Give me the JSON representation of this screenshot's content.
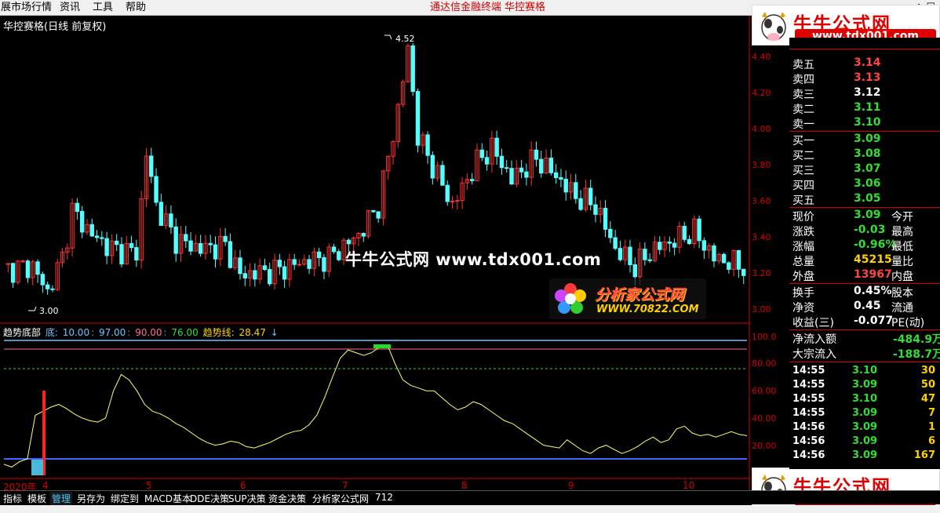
{
  "menu": {
    "items": [
      "展市场行情",
      "资讯",
      "工具",
      "帮助"
    ],
    "center_items": [
      "通达信金融终端",
      "华控赛格"
    ],
    "win_controls": "◇ ☐"
  },
  "chart": {
    "title": "华控赛格(日线 前复权)",
    "y_labels": [
      "4.40",
      "4.20",
      "4.00",
      "3.80",
      "3.60",
      "3.40",
      "3.20",
      "3.00"
    ],
    "high_label": "4.52",
    "low_label": "3.00",
    "ind_y_labels": [
      "100.0",
      "80.00",
      "60.00",
      "40.00",
      "20.00"
    ],
    "x_labels": [
      "2020年",
      "4",
      "5",
      "6",
      "7",
      "8",
      "9",
      "10"
    ]
  },
  "indicator": {
    "name": "趋势底部",
    "bottom_label": "底:",
    "v1": "10.00",
    "v2": "97.00",
    "v3": "90.00",
    "v4": "76.00",
    "trend_label": "趋势线:",
    "trend_value": "28.47",
    "arrow": "↓"
  },
  "watermark": {
    "center": "牛牛公式网 www.tdx001.com",
    "fx_title": "分析家公式网",
    "fx_url": "WWW.70822.COM"
  },
  "logos": {
    "title": "牛牛公式网",
    "url": "www.tdx001.com"
  },
  "quote": {
    "sells": [
      {
        "label": "卖五",
        "price": "3.14",
        "color": "#ff4444"
      },
      {
        "label": "卖四",
        "price": "3.13",
        "color": "#ff4444"
      },
      {
        "label": "卖三",
        "price": "3.12",
        "color": "#ffffff"
      },
      {
        "label": "卖二",
        "price": "3.11",
        "color": "#33dd33"
      },
      {
        "label": "卖一",
        "price": "3.10",
        "color": "#33dd33"
      }
    ],
    "buys": [
      {
        "label": "买一",
        "price": "3.09",
        "color": "#33dd33"
      },
      {
        "label": "买二",
        "price": "3.08",
        "color": "#33dd33"
      },
      {
        "label": "买三",
        "price": "3.07",
        "color": "#33dd33"
      },
      {
        "label": "买四",
        "price": "3.06",
        "color": "#33dd33"
      },
      {
        "label": "买五",
        "price": "3.05",
        "color": "#33dd33"
      }
    ],
    "stats": [
      {
        "label": "现价",
        "value": "3.09",
        "color": "#33dd33",
        "label2": "今开"
      },
      {
        "label": "涨跌",
        "value": "-0.03",
        "color": "#33dd33",
        "label2": "最高"
      },
      {
        "label": "涨幅",
        "value": "-0.96%",
        "color": "#33dd33",
        "label2": "最低"
      },
      {
        "label": "总量",
        "value": "45215",
        "color": "#ffd000",
        "label2": "量比"
      },
      {
        "label": "外盘",
        "value": "13967",
        "color": "#ff4444",
        "label2": "内盘"
      }
    ],
    "stats2": [
      {
        "label": "换手",
        "value": "0.45%",
        "color": "#ffffff",
        "label2": "股本"
      },
      {
        "label": "净资",
        "value": "0.45",
        "color": "#ffffff",
        "label2": "流通"
      },
      {
        "label": "收益(三)",
        "value": "-0.077",
        "color": "#ffffff",
        "label2": "PE(动)"
      }
    ],
    "flows": [
      {
        "label": "净流入额",
        "value": "-484.9万"
      },
      {
        "label": "大宗流入",
        "value": "-188.7万"
      }
    ]
  },
  "ticks": [
    {
      "time": "14:55",
      "price": "3.10",
      "color": "#33dd33",
      "vol": "30"
    },
    {
      "time": "14:55",
      "price": "3.09",
      "color": "#33dd33",
      "vol": "50"
    },
    {
      "time": "14:55",
      "price": "3.10",
      "color": "#33dd33",
      "vol": "47"
    },
    {
      "time": "14:55",
      "price": "3.09",
      "color": "#33dd33",
      "vol": "7"
    },
    {
      "time": "14:56",
      "price": "3.09",
      "color": "#33dd33",
      "vol": "1"
    },
    {
      "time": "14:56",
      "price": "3.09",
      "color": "#33dd33",
      "vol": "6"
    },
    {
      "time": "14:56",
      "price": "3.09",
      "color": "#33dd33",
      "vol": "167"
    }
  ],
  "toolbar": [
    "指标",
    "模板",
    "管理",
    "另存为",
    "绑定到",
    "MACD基本",
    "DDE决策",
    "SUP决策",
    "资金决策",
    "分析家公式网",
    "712"
  ],
  "toolbar_active": "管理",
  "chart_data": {
    "type": "candlestick",
    "y_range": [
      2.95,
      4.55
    ],
    "up_color": "#ff3232",
    "down_color": "#54ffff",
    "indicator_series": [
      6,
      4,
      8,
      10,
      42,
      45,
      48,
      50,
      47,
      43,
      40,
      38,
      37,
      40,
      60,
      72,
      68,
      60,
      50,
      45,
      43,
      40,
      36,
      33,
      29,
      25,
      22,
      20,
      21,
      23,
      22,
      19,
      18,
      20,
      22,
      25,
      28,
      30,
      31,
      35,
      42,
      55,
      70,
      84,
      90,
      88,
      86,
      88,
      92,
      94,
      80,
      68,
      64,
      62,
      60,
      60,
      55,
      50,
      46,
      48,
      52,
      50,
      46,
      42,
      38,
      36,
      32,
      28,
      24,
      20,
      19,
      18,
      24,
      20,
      16,
      14,
      18,
      20,
      17,
      14,
      16,
      19,
      23,
      26,
      22,
      24,
      32,
      34,
      29,
      27,
      28,
      26,
      28,
      30,
      28,
      27
    ],
    "indicator_levels": {
      "v1": 10,
      "v2": 97,
      "v3": 90,
      "v4": 76
    }
  }
}
